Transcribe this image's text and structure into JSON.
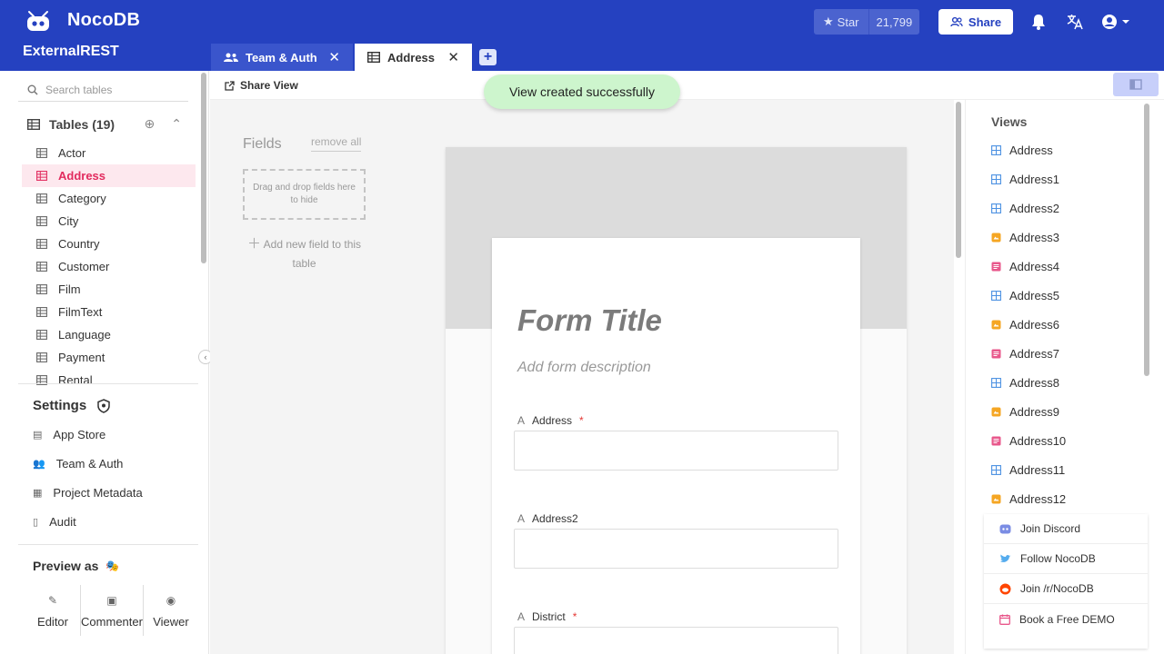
{
  "app": {
    "brand": "NocoDB",
    "project": "ExternalREST",
    "star_label": "Star",
    "star_count": "21,799",
    "share_label": "Share"
  },
  "tabs": [
    {
      "label": "Team & Auth"
    },
    {
      "label": "Address"
    }
  ],
  "sidebar": {
    "search_placeholder": "Search tables",
    "tables_heading": "Tables (19)",
    "tables": [
      "Actor",
      "Address",
      "Category",
      "City",
      "Country",
      "Customer",
      "Film",
      "FilmText",
      "Language",
      "Payment",
      "Rental"
    ],
    "active_table": "Address",
    "settings_heading": "Settings",
    "settings_items": [
      "App Store",
      "Team & Auth",
      "Project Metadata",
      "Audit"
    ],
    "preview_heading": "Preview as",
    "roles": [
      "Editor",
      "Commenter",
      "Viewer"
    ]
  },
  "toolbar": {
    "share_view": "Share View",
    "toast": "View created successfully"
  },
  "fields_panel": {
    "title": "Fields",
    "remove_all": "remove all",
    "drop_hint": "Drag and drop fields here to hide",
    "add_field": "Add new field to this table"
  },
  "form": {
    "title": "Form Title",
    "description": "Add form description",
    "fields": [
      {
        "label": "Address",
        "required": true
      },
      {
        "label": "Address2",
        "required": false
      },
      {
        "label": "District",
        "required": true
      }
    ],
    "required_mark": "*"
  },
  "views": {
    "title": "Views",
    "items": [
      {
        "label": "Address",
        "type": "grid"
      },
      {
        "label": "Address1",
        "type": "grid"
      },
      {
        "label": "Address2",
        "type": "grid"
      },
      {
        "label": "Address3",
        "type": "gallery"
      },
      {
        "label": "Address4",
        "type": "form"
      },
      {
        "label": "Address5",
        "type": "grid"
      },
      {
        "label": "Address6",
        "type": "gallery"
      },
      {
        "label": "Address7",
        "type": "form"
      },
      {
        "label": "Address8",
        "type": "grid"
      },
      {
        "label": "Address9",
        "type": "gallery"
      },
      {
        "label": "Address10",
        "type": "form"
      },
      {
        "label": "Address11",
        "type": "grid"
      },
      {
        "label": "Address12",
        "type": "gallery"
      }
    ]
  },
  "community": [
    "Join Discord",
    "Follow NocoDB",
    "Join /r/NocoDB",
    "Book a Free DEMO"
  ],
  "colors": {
    "header": "#2541c0",
    "active_table": "#e22b5e",
    "toast_bg": "#cdf5cd",
    "grid_icon": "#4a90e2",
    "gallery_icon": "#f5a623",
    "form_icon": "#e8578b"
  }
}
